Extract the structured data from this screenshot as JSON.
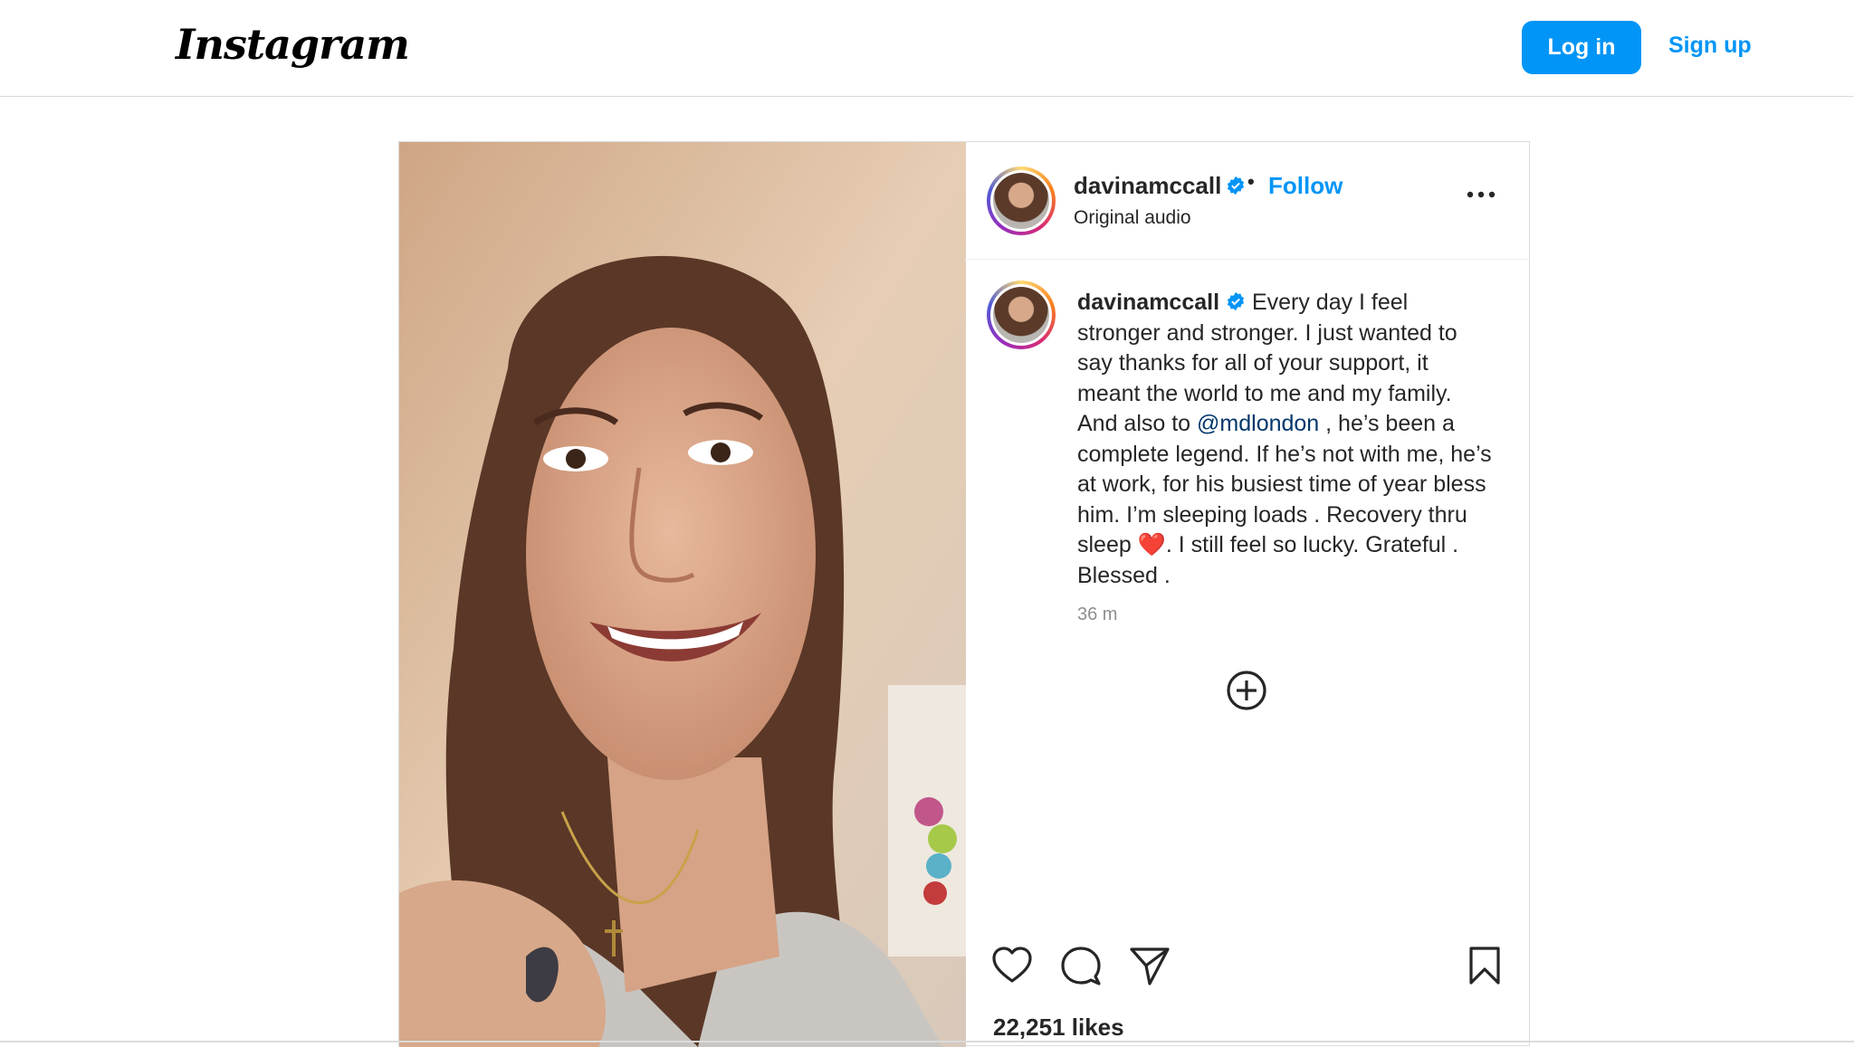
{
  "header": {
    "logo": "Instagram",
    "login_label": "Log in",
    "signup_label": "Sign up"
  },
  "post": {
    "username": "davinamccall",
    "follow_label": "Follow",
    "audio": "Original audio",
    "caption_text_1": "Every day I feel stronger and stronger. I just wanted to say thanks for all of your support, it meant the world to me and my family. And also to ",
    "mention": "@mdlondon",
    "caption_text_2": " , he’s been a complete legend. If he’s not with me, he’s at work, for his busiest time of year bless him. I’m sleeping loads . Recovery thru sleep ",
    "emoji": "❤️",
    "caption_text_3": ". I still feel so lucky. Grateful . Blessed .",
    "time_ago": "36 m",
    "likes": "22,251 likes",
    "icons": [
      "more-icon",
      "add-comment-icon",
      "heart-icon",
      "comment-icon",
      "share-icon",
      "bookmark-icon",
      "verified-icon"
    ]
  },
  "colors": {
    "accent": "#0095f6",
    "mention": "#00376b",
    "muted": "#8e8e8e",
    "border": "#dbdbdb"
  }
}
